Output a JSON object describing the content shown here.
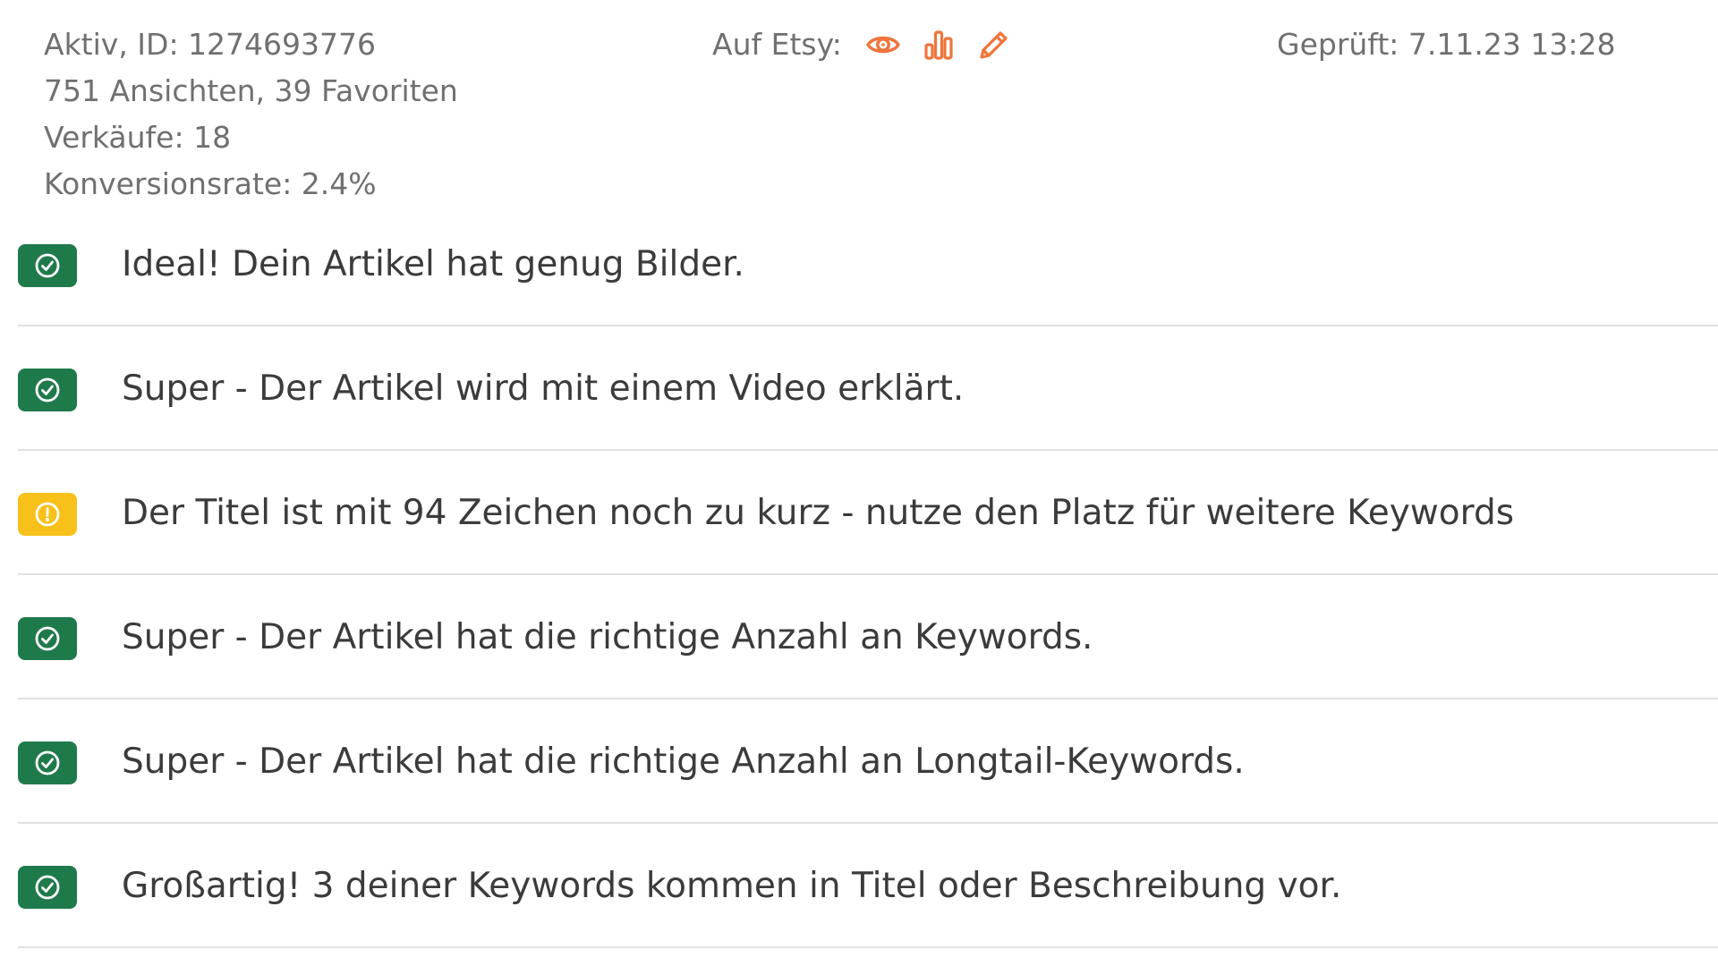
{
  "listing": {
    "status_id": "Aktiv, ID: 1274693776",
    "views_favorites": "751 Ansichten, 39 Favoriten",
    "sales": "Verkäufe: 18",
    "conversion": "Konversionsrate: 2.4%"
  },
  "etsy": {
    "label": "Auf Etsy:",
    "icons": [
      "eye-icon",
      "bar-chart-icon",
      "pencil-icon"
    ],
    "accent_color": "#f0743b"
  },
  "checked": {
    "text": "Geprüft: 7.11.23 13:28"
  },
  "colors": {
    "ok": "#1f7a4b",
    "warn": "#f8c11a",
    "divider": "#e1e1e1"
  },
  "checks": [
    {
      "status": "ok",
      "icon": "check-circle-icon",
      "text": "Ideal! Dein Artikel hat genug Bilder."
    },
    {
      "status": "ok",
      "icon": "check-circle-icon",
      "text": "Super - Der Artikel wird mit einem Video erklärt."
    },
    {
      "status": "warn",
      "icon": "exclamation-circle-icon",
      "text": "Der Titel ist mit 94 Zeichen noch zu kurz - nutze den Platz für weitere Keywords"
    },
    {
      "status": "ok",
      "icon": "check-circle-icon",
      "text": "Super - Der Artikel hat die richtige Anzahl an Keywords."
    },
    {
      "status": "ok",
      "icon": "check-circle-icon",
      "text": "Super - Der Artikel hat die richtige Anzahl an Longtail-Keywords."
    },
    {
      "status": "ok",
      "icon": "check-circle-icon",
      "text": "Großartig! 3 deiner Keywords kommen in Titel oder Beschreibung vor."
    }
  ]
}
